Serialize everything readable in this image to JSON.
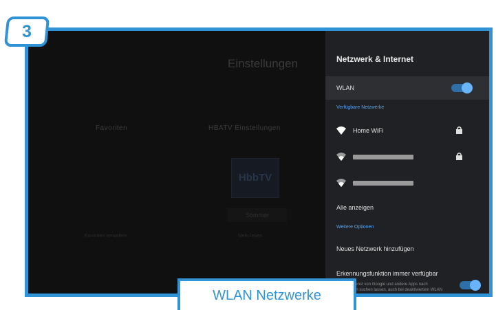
{
  "step": {
    "number": "3"
  },
  "caption": "WLAN Netzwerke",
  "background_app": {
    "title": "Einstellungen",
    "cards": [
      {
        "title": "Favoriten",
        "footer": "Favoriten verwalten"
      },
      {
        "title": "HBATV Einstellungen",
        "logo": "HbbTV",
        "item": "Sommer",
        "footer": "Mehr lesen"
      }
    ]
  },
  "panel": {
    "title": "Netzwerk & Internet",
    "wlan_label": "WLAN",
    "wlan_enabled": true,
    "available_networks_header": "Verfügbare Netzwerke",
    "networks": [
      {
        "name": "Home WiFi",
        "locked": true
      },
      {
        "name": "",
        "locked": true
      },
      {
        "name": "",
        "locked": false
      }
    ],
    "show_all": "Alle anzeigen",
    "more_options_header": "Weitere Optionen",
    "add_network": "Neues Netzwerk hinzufügen",
    "scanning_label": "Erkennungsfunktion immer verfügbar",
    "scanning_desc": "Standortdienst von Google und andere Apps nach Netzwerken suchen lassen, auch bei deaktiviertem WLAN noch",
    "scanning_enabled": true
  },
  "colors": {
    "accent": "#2f93d6",
    "toggle_on": "#6ab4ff",
    "panel_bg": "#202124"
  }
}
